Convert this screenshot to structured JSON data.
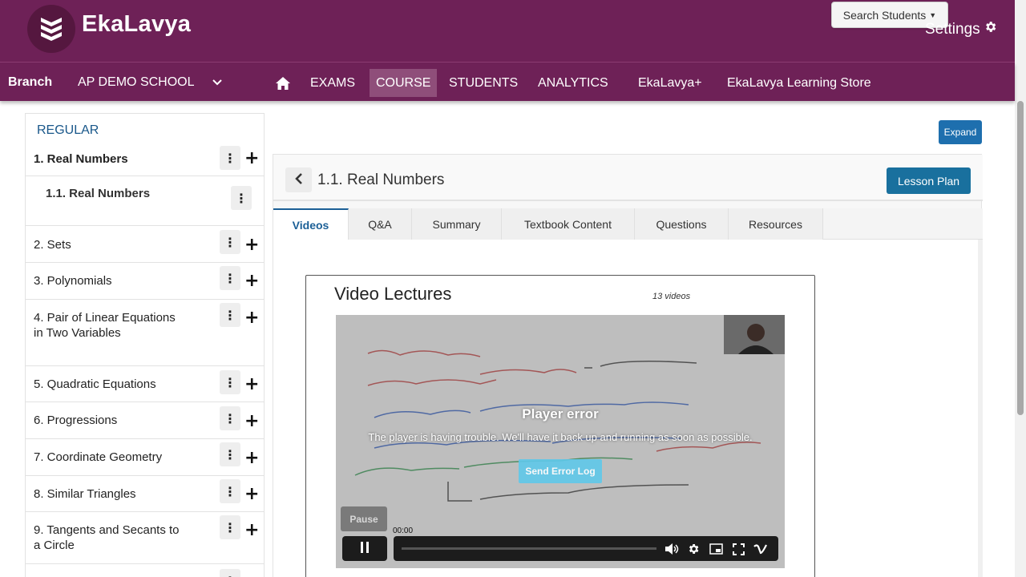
{
  "header": {
    "brand": "EkaLavya",
    "search_students": "Search Students",
    "settings": "Settings"
  },
  "nav": {
    "branch_label": "Branch",
    "branch_value": "AP DEMO SCHOOL",
    "items": [
      "EXAMS",
      "COURSE",
      "STUDENTS",
      "ANALYTICS",
      "EkaLavya+",
      "EkaLavya Learning Store"
    ],
    "active": "COURSE"
  },
  "sidebar": {
    "header": "REGULAR",
    "chapters": [
      {
        "label": "1. Real Numbers"
      },
      {
        "label": "1.1. Real Numbers"
      },
      {
        "label": "2. Sets"
      },
      {
        "label": "3. Polynomials"
      },
      {
        "label": "4. Pair of Linear Equations in Two Variables"
      },
      {
        "label": "5. Quadratic Equations"
      },
      {
        "label": "6. Progressions"
      },
      {
        "label": "7. Coordinate Geometry"
      },
      {
        "label": "8. Similar Triangles"
      },
      {
        "label": "9. Tangents and Secants to a Circle"
      }
    ]
  },
  "main": {
    "expand": "Expand",
    "lesson_title": "1.1. Real Numbers",
    "lesson_plan": "Lesson Plan",
    "tabs": [
      "Videos",
      "Q&A",
      "Summary",
      "Textbook Content",
      "Questions",
      "Resources"
    ],
    "active_tab": "Videos"
  },
  "video": {
    "title": "Video Lectures",
    "count": "13 videos",
    "error_title": "Player error",
    "error_message": "The player is having trouble. We'll have it back up and running as soon as possible.",
    "error_button": "Send Error Log",
    "pause_tooltip": "Pause",
    "time": "00:00"
  },
  "colors": {
    "brand": "#6e2157",
    "accent": "#1e6fae",
    "tab_active": "#1b5f96"
  }
}
